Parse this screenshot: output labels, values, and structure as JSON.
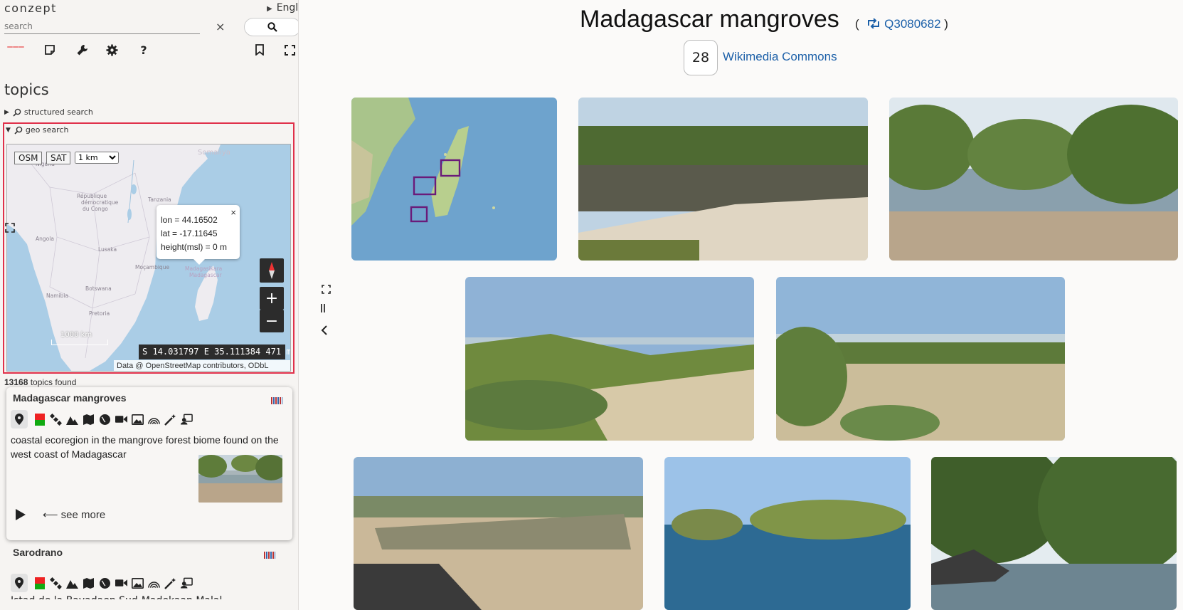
{
  "app": {
    "brand": "conzept",
    "language": "English"
  },
  "search": {
    "placeholder": "search",
    "clear_label": "×"
  },
  "toolbar": {
    "icons": [
      "menu-icon",
      "notes-icon",
      "wrench-icon",
      "gear-icon",
      "help-icon",
      "bookmark-icon",
      "fullscreen-icon"
    ],
    "help_label": "?"
  },
  "topics": {
    "title": "topics",
    "structured_search": "structured search",
    "geo_search": "geo search"
  },
  "map": {
    "layer_buttons": [
      "OSM",
      "SAT"
    ],
    "scale_select": "1 km",
    "popup": {
      "lon": "lon = 44.16502",
      "lat": "lat = -17.11645",
      "height": "height(msl) = 0 m",
      "close": "×"
    },
    "coords": "S 14.031797 E 35.111384  471 m",
    "scale_label": "1000 km",
    "attribution": "Data @ OpenStreetMap contributors, ODbL",
    "zoom_in": "+",
    "zoom_out": "−"
  },
  "results": {
    "count": "13168",
    "count_suffix": " topics found",
    "items": [
      {
        "title": "Madagascar mangroves",
        "description": "coastal ecoregion in the mangrove forest biome found on the west coast of Madagascar",
        "see_more": "⟵ see more"
      },
      {
        "title": "Sarodrano",
        "description": "Istad de la Bayadaen Sud-Madekaan Malal..."
      }
    ]
  },
  "main": {
    "title": "Madagascar mangroves",
    "open_paren": "(",
    "qid": "Q3080682",
    "close_paren": ")",
    "image_count": "28",
    "source_link": "Wikimedia Commons"
  },
  "colors": {
    "accent_red": "#e0304a",
    "link_blue": "#1b5fa8",
    "map_water": "#aacde6"
  }
}
